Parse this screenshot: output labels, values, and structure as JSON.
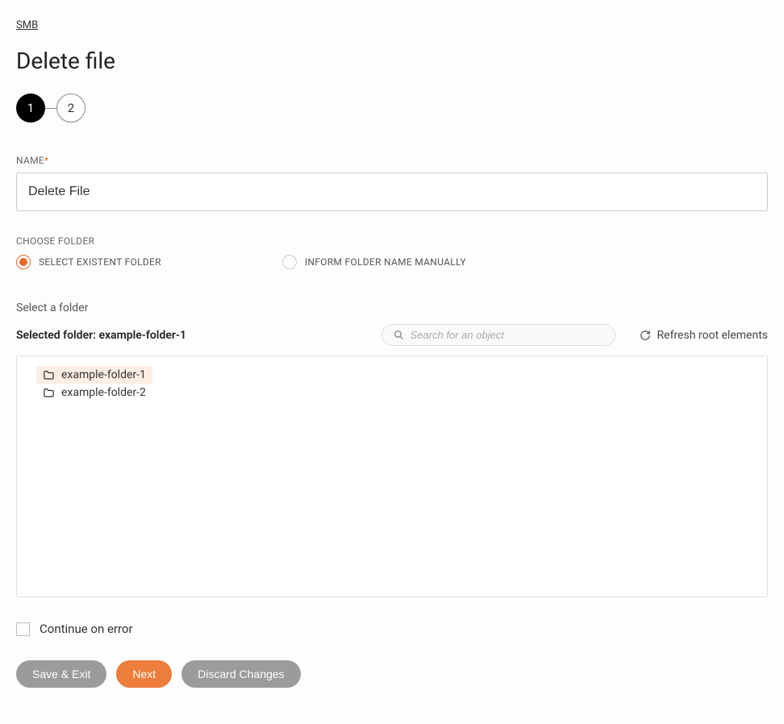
{
  "breadcrumb": "SMB",
  "page_title": "Delete file",
  "stepper": {
    "step1": "1",
    "step2": "2"
  },
  "name_field": {
    "label": "NAME",
    "value": "Delete File"
  },
  "choose_folder": {
    "label": "CHOOSE FOLDER",
    "option_existent": "SELECT EXISTENT FOLDER",
    "option_manual": "INFORM FOLDER NAME MANUALLY"
  },
  "folder_section": {
    "heading": "Select a folder",
    "selected_prefix": "Selected folder: ",
    "selected_value": "example-folder-1",
    "search_placeholder": "Search for an object",
    "refresh_label": "Refresh root elements"
  },
  "tree": {
    "items": [
      {
        "name": "example-folder-1",
        "selected": true
      },
      {
        "name": "example-folder-2",
        "selected": false
      }
    ]
  },
  "continue_on_error_label": "Continue on error",
  "buttons": {
    "save_exit": "Save & Exit",
    "next": "Next",
    "discard": "Discard Changes"
  }
}
